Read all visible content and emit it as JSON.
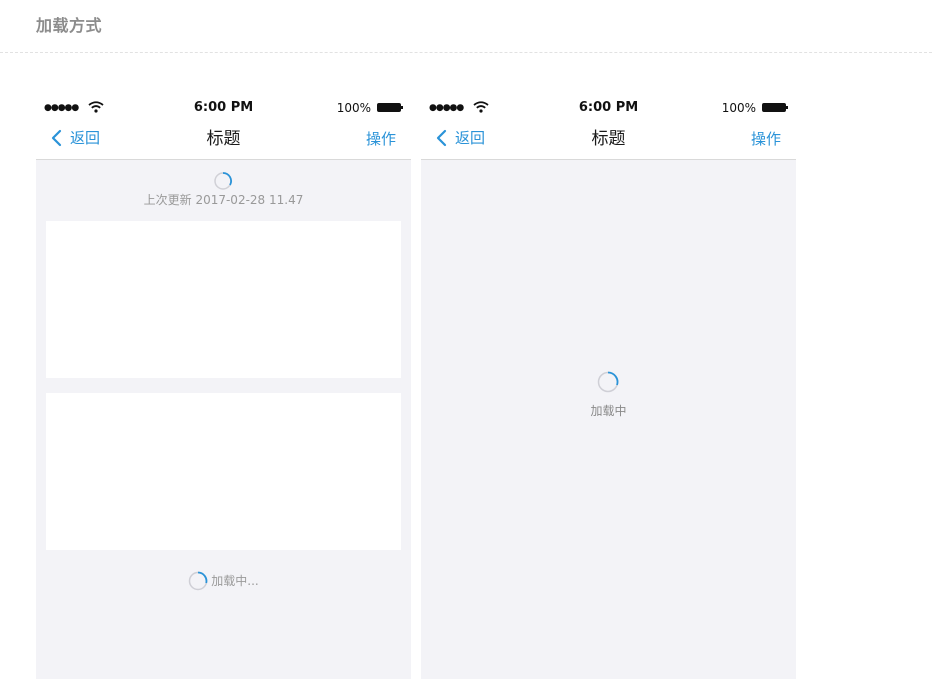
{
  "page": {
    "title": "加载方式"
  },
  "status_bar": {
    "signal": "●●●●●",
    "time": "6:00 PM",
    "battery": "100%"
  },
  "nav_bar": {
    "back_label": "返回",
    "title": "标题",
    "action_label": "操作"
  },
  "pull_refresh": {
    "last_updated": "上次更新 2017-02-28 11.47"
  },
  "load_more": {
    "text": "加载中..."
  },
  "full_loading": {
    "text": "加载中"
  },
  "colors": {
    "accent": "#2a93d8",
    "background": "#f3f3f7",
    "card": "#ffffff"
  },
  "icons": [
    "wifi-icon",
    "battery-icon",
    "back-chevron-icon",
    "spinner-icon"
  ]
}
